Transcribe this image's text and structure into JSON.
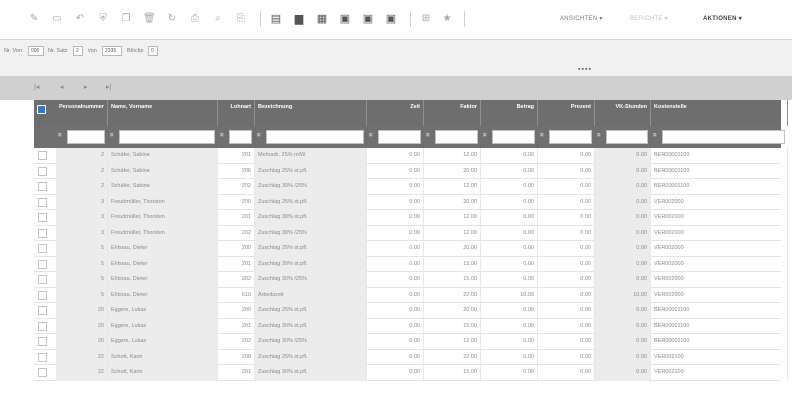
{
  "toolbar": {
    "icons": [
      {
        "name": "new-record-icon",
        "glyph": "✎"
      },
      {
        "name": "save-icon",
        "glyph": "▭"
      },
      {
        "name": "undo-icon",
        "glyph": "↶"
      },
      {
        "name": "lock-icon",
        "glyph": "⛨"
      },
      {
        "name": "copy-icon",
        "glyph": "❐"
      },
      {
        "name": "delete-icon",
        "glyph": "🗑"
      },
      {
        "name": "refresh-icon",
        "glyph": "↻"
      },
      {
        "name": "print-icon",
        "glyph": "⎙"
      },
      {
        "name": "search-icon",
        "glyph": "⌕"
      },
      {
        "name": "attachment-icon",
        "glyph": "⎘"
      }
    ],
    "dark_icons": [
      {
        "name": "report-icon",
        "glyph": "▤"
      },
      {
        "name": "folder-icon",
        "glyph": "▆"
      },
      {
        "name": "document-icon",
        "glyph": "▦"
      },
      {
        "name": "archive-icon",
        "glyph": "▣"
      },
      {
        "name": "form-icon",
        "glyph": "▣"
      },
      {
        "name": "export-icon",
        "glyph": "▣"
      }
    ],
    "extra_icons": [
      {
        "name": "filter-icon",
        "glyph": "⊞"
      },
      {
        "name": "favorite-icon",
        "glyph": "★"
      }
    ],
    "menus": [
      {
        "label": "ANSICHTEN ▾",
        "style": ""
      },
      {
        "label": "BERICHTE ▾",
        "style": "faint"
      },
      {
        "label": "AKTIONEN ▾",
        "style": "bold"
      }
    ]
  },
  "paging": {
    "from_label": "Nr. Von",
    "from_value": "000",
    "to_label": "Nr. Satz",
    "to_value": "2",
    "of_label": "von",
    "of_value": "2335",
    "rows_label": "Blöcke",
    "rows_value": "0",
    "dots": "▪▪▪▪"
  },
  "nav": [
    "|◂",
    "◂",
    "▸",
    "▸|"
  ],
  "columns": [
    {
      "key": "pers",
      "label": "Personalnummer",
      "w": 52,
      "align": "r"
    },
    {
      "key": "name",
      "label": "Name, Vorname",
      "w": 110,
      "align": "l"
    },
    {
      "key": "lohnart",
      "label": "Lohnart",
      "w": 37,
      "align": "r"
    },
    {
      "key": "bez",
      "label": "Bezeichnung",
      "w": 112,
      "align": "l"
    },
    {
      "key": "zeit",
      "label": "Zeit",
      "w": 57,
      "align": "r"
    },
    {
      "key": "faktor",
      "label": "Faktor",
      "w": 57,
      "align": "r"
    },
    {
      "key": "betrag",
      "label": "Betrag",
      "w": 57,
      "align": "r"
    },
    {
      "key": "prozent",
      "label": "Prozent",
      "w": 57,
      "align": "r"
    },
    {
      "key": "vk",
      "label": "VK-Stunden",
      "w": 56,
      "align": "r"
    },
    {
      "key": "kst",
      "label": "Kostenstelle",
      "w": 137,
      "align": "l"
    }
  ],
  "filter_op": "=",
  "rows": [
    {
      "pers": "2",
      "name": "Schäfer, Sabine",
      "lohnart": "201",
      "bez": "Mehrarb. 25% m/W",
      "zeit": "0.00",
      "faktor": "12.00",
      "betrag": "0.00",
      "prozent": "0.00",
      "vk": "0.00",
      "kst": "BER00001100"
    },
    {
      "pers": "2",
      "name": "Schäfer, Sabine",
      "lohnart": "206",
      "bez": "Zuschlag 25% st.pfl.",
      "zeit": "0.00",
      "faktor": "20.00",
      "betrag": "0.00",
      "prozent": "0.00",
      "vk": "0.00",
      "kst": "BER00001100"
    },
    {
      "pers": "2",
      "name": "Schäfer, Sabine",
      "lohnart": "202",
      "bez": "Zuschlag 30% /25%",
      "zeit": "0.00",
      "faktor": "12.00",
      "betrag": "0.00",
      "prozent": "0.00",
      "vk": "0.00",
      "kst": "BER00001100"
    },
    {
      "pers": "3",
      "name": "Freudmüller, Thorsten",
      "lohnart": "200",
      "bez": "Zuschlag 25% st.pfl.",
      "zeit": "0.00",
      "faktor": "20.00",
      "betrag": "0.00",
      "prozent": "0.00",
      "vk": "0.00",
      "kst": "VER002000"
    },
    {
      "pers": "3",
      "name": "Freudmüller, Thorsten",
      "lohnart": "201",
      "bez": "Zuschlag 30% st.pfl.",
      "zeit": "0.00",
      "faktor": "12.00",
      "betrag": "0.00",
      "prozent": "0.00",
      "vk": "0.00",
      "kst": "VER002000"
    },
    {
      "pers": "3",
      "name": "Freudmüller, Thorsten",
      "lohnart": "202",
      "bez": "Zuschlag 30% /25%",
      "zeit": "0.00",
      "faktor": "12.00",
      "betrag": "0.00",
      "prozent": "0.00",
      "vk": "0.00",
      "kst": "VER002000"
    },
    {
      "pers": "5",
      "name": "Ehlsrau, Dieter",
      "lohnart": "200",
      "bez": "Zuschlag 25% st.pfl.",
      "zeit": "0.00",
      "faktor": "20.00",
      "betrag": "0.00",
      "prozent": "0.00",
      "vk": "0.00",
      "kst": "VER002000"
    },
    {
      "pers": "5",
      "name": "Ehlsrau, Dieter",
      "lohnart": "201",
      "bez": "Zuschlag 30% st.pfl.",
      "zeit": "0.00",
      "faktor": "15.00",
      "betrag": "0.00",
      "prozent": "0.00",
      "vk": "0.00",
      "kst": "VER002000"
    },
    {
      "pers": "5",
      "name": "Ehlsrau, Dieter",
      "lohnart": "202",
      "bez": "Zuschlag 30% /25%",
      "zeit": "0.00",
      "faktor": "15.00",
      "betrag": "0.00",
      "prozent": "0.00",
      "vk": "0.00",
      "kst": "VER002000"
    },
    {
      "pers": "5",
      "name": "Ehlsrau, Dieter",
      "lohnart": "610",
      "bez": "Arbeitszeit",
      "zeit": "0.00",
      "faktor": "22.00",
      "betrag": "10.00",
      "prozent": "0.00",
      "vk": "10.00",
      "kst": "VER002000"
    },
    {
      "pers": "20",
      "name": "Eggers, Lukas",
      "lohnart": "200",
      "bez": "Zuschlag 25% st.pfl.",
      "zeit": "0.00",
      "faktor": "20.00",
      "betrag": "0.00",
      "prozent": "0.00",
      "vk": "0.00",
      "kst": "BER00001100"
    },
    {
      "pers": "20",
      "name": "Eggers, Lukas",
      "lohnart": "201",
      "bez": "Zuschlag 30% st.pfl.",
      "zeit": "0.00",
      "faktor": "15.00",
      "betrag": "0.00",
      "prozent": "0.00",
      "vk": "0.00",
      "kst": "BER00001100"
    },
    {
      "pers": "20",
      "name": "Eggers, Lukas",
      "lohnart": "202",
      "bez": "Zuschlag 30% /25%",
      "zeit": "0.00",
      "faktor": "12.00",
      "betrag": "0.00",
      "prozent": "0.00",
      "vk": "0.00",
      "kst": "BER00001100"
    },
    {
      "pers": "22",
      "name": "Schott, Karin",
      "lohnart": "200",
      "bez": "Zuschlag 25% st.pfl.",
      "zeit": "0.00",
      "faktor": "22.00",
      "betrag": "0.00",
      "prozent": "0.00",
      "vk": "0.00",
      "kst": "VER002100"
    },
    {
      "pers": "22",
      "name": "Schott, Karin",
      "lohnart": "201",
      "bez": "Zuschlag 30% st.pfl.",
      "zeit": "0.00",
      "faktor": "15.00",
      "betrag": "0.00",
      "prozent": "0.00",
      "vk": "0.00",
      "kst": "VER002100"
    }
  ]
}
